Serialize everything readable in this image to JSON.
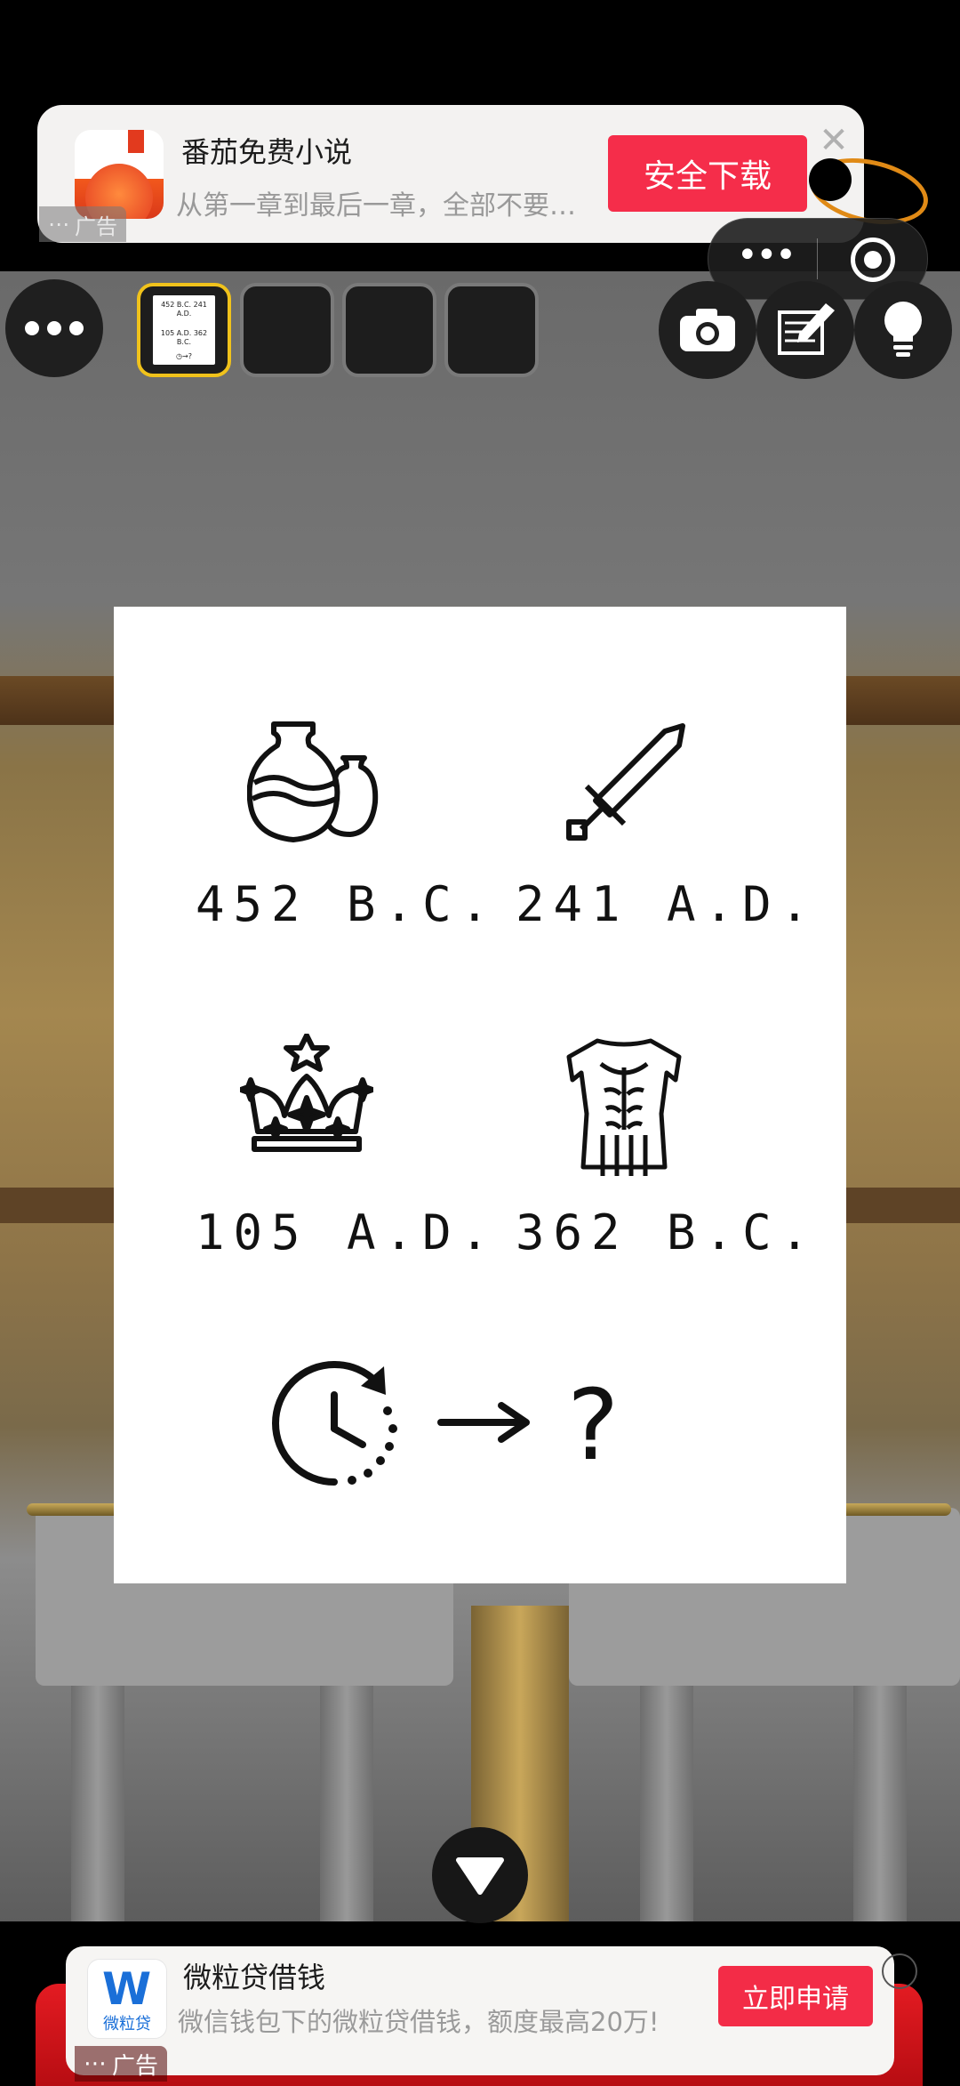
{
  "top_ad": {
    "app_name": "番茄免费小说",
    "description": "从第一章到最后一章，全部不要…",
    "download_label": "安全下载",
    "close_symbol": "✕",
    "ad_tag": "广告"
  },
  "bottom_ad": {
    "app_name": "微粒贷借钱",
    "description": "微信钱包下的微粒贷借钱，额度最高20万!",
    "apply_label": "立即申请",
    "icon_letter": "W",
    "icon_caption": "微粒贷",
    "ad_tag": "广告"
  },
  "thumbnail_text": [
    "452 B.C.",
    "241 A.D.",
    "105 A.D.",
    "362 B.C.",
    "→?"
  ],
  "puzzle": {
    "items": [
      {
        "icon": "vase-icon",
        "label": "452 B.C."
      },
      {
        "icon": "sword-icon",
        "label": "241 A.D."
      },
      {
        "icon": "crown-icon",
        "label": "105 A.D."
      },
      {
        "icon": "armor-icon",
        "label": "362 B.C."
      }
    ],
    "question": "?"
  },
  "colors": {
    "ad_button": "#f52d4a",
    "slot_active": "#f0c21b",
    "loan_blue": "#1a6fd8"
  }
}
